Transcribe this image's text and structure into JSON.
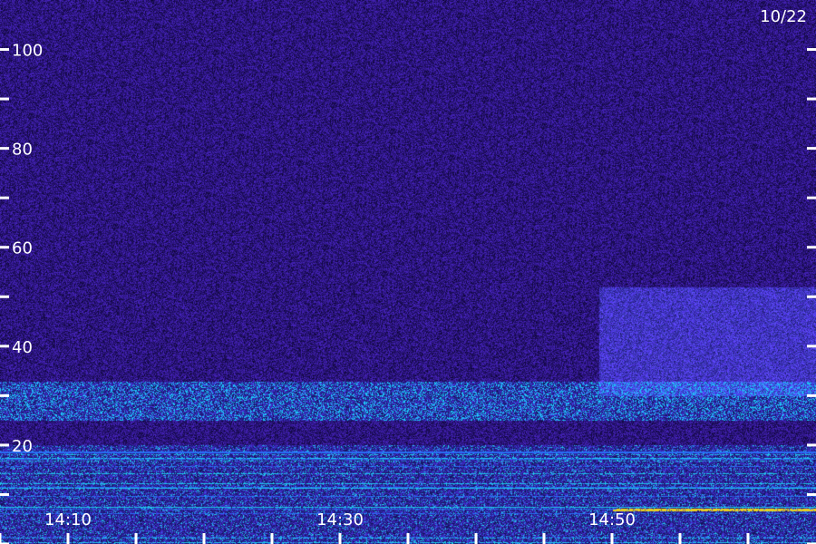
{
  "chart_data": {
    "type": "heatmap",
    "title": "",
    "date_label": "10/22",
    "xlabel": "",
    "ylabel": "",
    "xlim": [
      "14:05",
      "15:05"
    ],
    "ylim": [
      0,
      110
    ],
    "x_tick_labels": [
      "14:10",
      "14:30",
      "14:50"
    ],
    "x_tick_label_values": [
      "14:10",
      "14:30",
      "14:50"
    ],
    "x_minor_tick_values": [
      "14:05",
      "14:10",
      "14:15",
      "14:20",
      "14:25",
      "14:30",
      "14:35",
      "14:40",
      "14:45",
      "14:50",
      "14:55",
      "15:00"
    ],
    "y_tick_labels": [
      "20",
      "40",
      "60",
      "80",
      "100"
    ],
    "y_tick_label_values": [
      20,
      40,
      60,
      80,
      100
    ],
    "y_minor_tick_values": [
      0,
      10,
      20,
      30,
      40,
      50,
      60,
      70,
      80,
      90,
      100
    ],
    "grid": false,
    "colormap": [
      "#1a0a4a",
      "#2a1680",
      "#3a2ac0",
      "#2f6ff0",
      "#22d8e8",
      "#3cf08a",
      "#e8d020"
    ],
    "background_color": "#2a1a78",
    "features": [
      {
        "description": "broadband noise band",
        "y_range": [
          25,
          33
        ],
        "x_range": [
          "14:05",
          "15:05"
        ]
      },
      {
        "description": "strong low-frequency lines",
        "y_range": [
          0,
          20
        ],
        "x_range": [
          "14:05",
          "15:05"
        ]
      },
      {
        "description": "elevated energy patch",
        "y_range": [
          30,
          52
        ],
        "x_range": [
          "14:49",
          "15:05"
        ]
      },
      {
        "description": "yellow tone",
        "y_range": [
          7,
          8
        ],
        "x_range": [
          "14:50",
          "15:05"
        ]
      }
    ]
  }
}
